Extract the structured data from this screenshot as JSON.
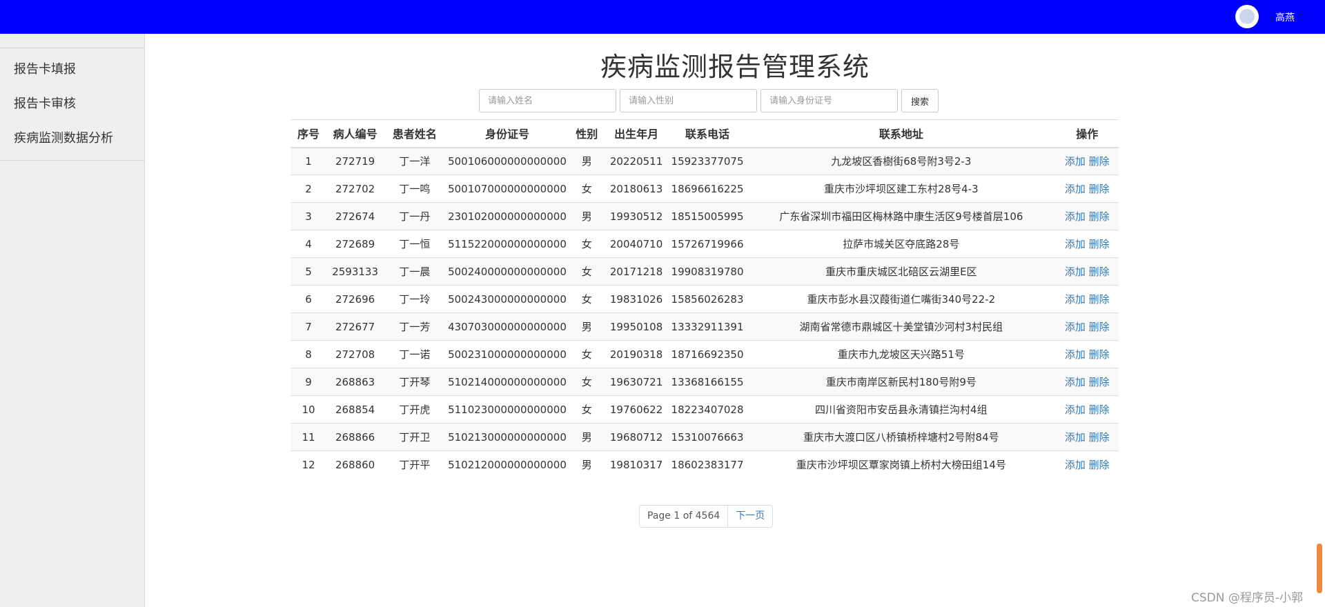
{
  "header": {
    "avatar_alt": "bai",
    "username": "高燕"
  },
  "sidebar": {
    "items": [
      {
        "label": "报告卡填报"
      },
      {
        "label": "报告卡审核"
      },
      {
        "label": "疾病监测数据分析"
      }
    ]
  },
  "main": {
    "title": "疾病监测报告管理系统",
    "search": {
      "name_placeholder": "请输入姓名",
      "gender_placeholder": "请输入性别",
      "id_placeholder": "请输入身份证号",
      "button_label": "搜索"
    },
    "table": {
      "headers": [
        "序号",
        "病人编号",
        "患者姓名",
        "身份证号",
        "性别",
        "出生年月",
        "联系电话",
        "联系地址",
        "操作"
      ],
      "action_add": "添加",
      "action_delete": "删除",
      "rows": [
        [
          "1",
          "272719",
          "丁一洋",
          "500106000000000000",
          "男",
          "20220511",
          "15923377075",
          "九龙坡区香樹街68号附3号2-3"
        ],
        [
          "2",
          "272702",
          "丁一鸣",
          "500107000000000000",
          "女",
          "20180613",
          "18696616225",
          "重庆市沙坪坝区建工东村28号4-3"
        ],
        [
          "3",
          "272674",
          "丁一丹",
          "230102000000000000",
          "男",
          "19930512",
          "18515005995",
          "广东省深圳市福田区梅林路中康生活区9号楼首层106"
        ],
        [
          "4",
          "272689",
          "丁一恒",
          "511522000000000000",
          "女",
          "20040710",
          "15726719966",
          "拉萨市城关区夺底路28号"
        ],
        [
          "5",
          "2593133",
          "丁一晨",
          "500240000000000000",
          "女",
          "20171218",
          "19908319780",
          "重庆市重庆城区北碚区云湖里E区"
        ],
        [
          "6",
          "272696",
          "丁一玲",
          "500243000000000000",
          "女",
          "19831026",
          "15856026283",
          "重庆市彭水县汉葭街道仁嘴街340号22-2"
        ],
        [
          "7",
          "272677",
          "丁一芳",
          "430703000000000000",
          "男",
          "19950108",
          "13332911391",
          "湖南省常德市鼎城区十美堂镇沙河村3村民组"
        ],
        [
          "8",
          "272708",
          "丁一诺",
          "500231000000000000",
          "女",
          "20190318",
          "18716692350",
          "重庆市九龙坡区天兴路51号"
        ],
        [
          "9",
          "268863",
          "丁开琴",
          "510214000000000000",
          "女",
          "19630721",
          "13368166155",
          "重庆市南岸区新民村180号附9号"
        ],
        [
          "10",
          "268854",
          "丁开虎",
          "511023000000000000",
          "女",
          "19760622",
          "18223407028",
          "四川省资阳市安岳县永清镇拦沟村4组"
        ],
        [
          "11",
          "268866",
          "丁开卫",
          "510213000000000000",
          "男",
          "19680712",
          "15310076663",
          "重庆市大渡口区八桥镇桥梓塘村2号附84号"
        ],
        [
          "12",
          "268860",
          "丁开平",
          "510212000000000000",
          "男",
          "19810317",
          "18602383177",
          "重庆市沙坪坝区覃家岗镇上桥村大榜田组14号"
        ]
      ]
    },
    "pagination": {
      "page_info": "Page 1 of 4564",
      "next_label": "下一页"
    }
  },
  "watermark": "CSDN @程序员-小郭"
}
